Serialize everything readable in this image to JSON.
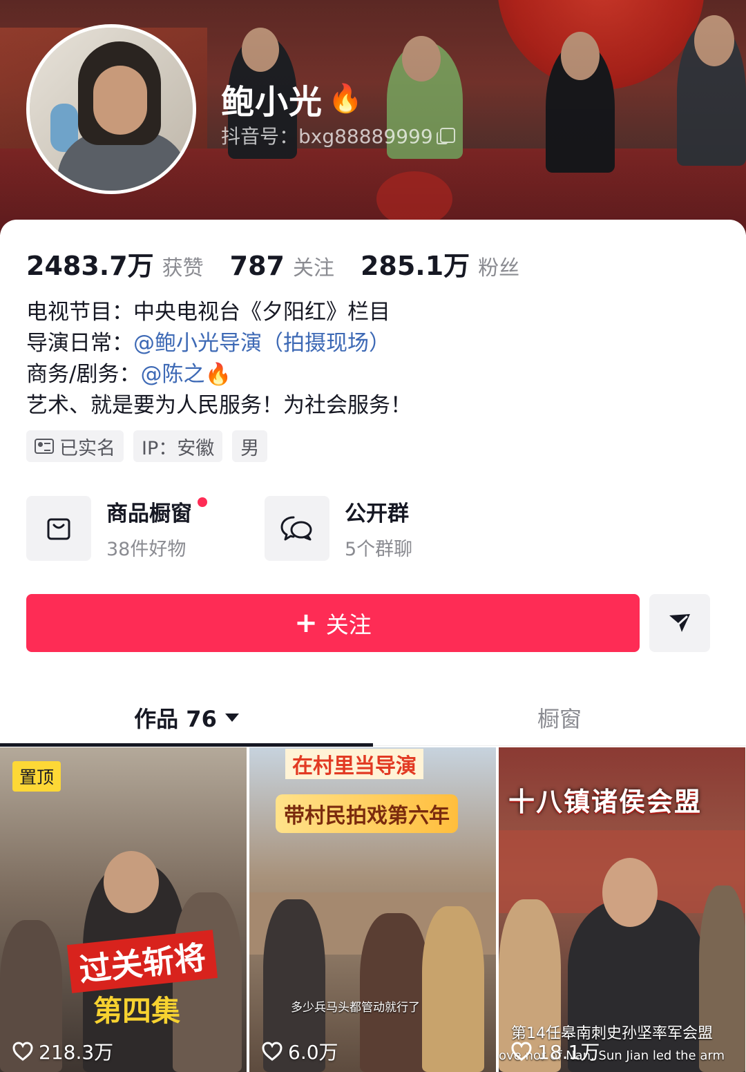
{
  "profile": {
    "name": "鲍小光",
    "name_badge_icon": "fire-icon",
    "douyin_id": "抖音号：bxg88889999"
  },
  "stats": [
    {
      "value": "2483.7万",
      "label": "获赞"
    },
    {
      "value": "787",
      "label": "关注"
    },
    {
      "value": "285.1万",
      "label": "粉丝"
    }
  ],
  "bio": {
    "line1": "电视节目：中央电视台《夕阳红》栏目",
    "line2_prefix": "导演日常：",
    "line2_link": "@鲍小光导演（拍摄现场）",
    "line3_prefix": "商务/剧务：",
    "line3_link": "@陈之",
    "line4": "艺术、就是要为人民服务！为社会服务！"
  },
  "tags": [
    "已实名",
    "IP：安徽",
    "男"
  ],
  "entries": [
    {
      "title": "商品橱窗",
      "sub": "38件好物",
      "icon": "shopping-bag-icon",
      "has_dot": true
    },
    {
      "title": "公开群",
      "sub": "5个群聊",
      "icon": "chat-bubbles-icon",
      "has_dot": false
    }
  ],
  "actions": {
    "follow_label": "关注",
    "share_icon": "send-arrow-icon"
  },
  "tabs": [
    {
      "label": "作品 76",
      "active": true
    },
    {
      "label": "橱窗",
      "active": false
    }
  ],
  "videos": [
    {
      "pinned_label": "置顶",
      "title": "过关斩将",
      "subtitle": "第四集",
      "likes": "218.3万"
    },
    {
      "top_text": "在村里当导演",
      "title": "带村民拍戏第六年",
      "caption": "多少兵马头都管动就行了",
      "likes": "6.0万"
    },
    {
      "title": "十八镇诸侯会盟",
      "caption": "第14任皋南刺史孙坚率军会盟",
      "caption_en": "ove nor of Nan, Sun Jian led the arm",
      "likes": "18.1万"
    }
  ],
  "colors": {
    "accent": "#fe2c55",
    "link": "#3d69b5",
    "pin_badge": "#fdd836"
  }
}
